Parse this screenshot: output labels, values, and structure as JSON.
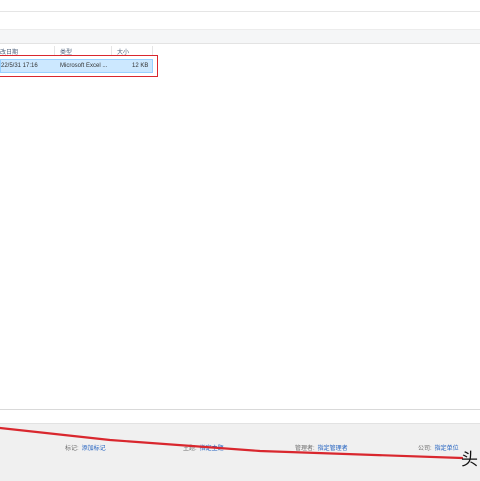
{
  "columns": {
    "date_modified": "改日期",
    "type": "类型",
    "size": "大小"
  },
  "file": {
    "date_modified": "22/5/31 17:16",
    "type": "Microsoft Excel ...",
    "size": "12 KB"
  },
  "details_pane": {
    "tags_label": "标记:",
    "tags_value": "添加标记",
    "subject_label": "主题:",
    "subject_value": "指定主题",
    "manager_label": "管理者:",
    "manager_value": "指定管理者",
    "company_label": "公司:",
    "company_value": "指定单位"
  },
  "watermark": "头",
  "colors": {
    "selection_bg": "#cce8ff",
    "annotation_red": "#d9272e",
    "link_blue": "#1f5fbf"
  }
}
